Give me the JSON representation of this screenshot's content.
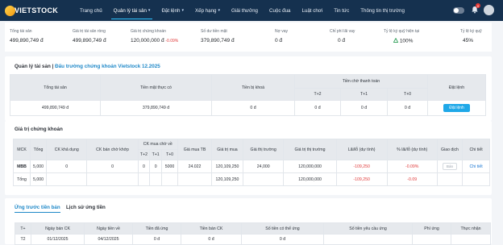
{
  "header": {
    "logo_text": "VIETSTOCK",
    "nav": [
      {
        "label": "Trang chủ",
        "active": false,
        "caret": false
      },
      {
        "label": "Quản lý tài sản",
        "active": true,
        "caret": true
      },
      {
        "label": "Đặt lệnh",
        "active": false,
        "caret": true
      },
      {
        "label": "Xếp hạng",
        "active": false,
        "caret": true
      },
      {
        "label": "Giải thưởng",
        "active": false,
        "caret": false
      },
      {
        "label": "Cuộc đua",
        "active": false,
        "caret": false
      },
      {
        "label": "Luật chơi",
        "active": false,
        "caret": false
      },
      {
        "label": "Tin tức",
        "active": false,
        "caret": false
      },
      {
        "label": "Thông tin thị trường",
        "active": false,
        "caret": false
      }
    ],
    "notification_count": "0",
    "caret_glyph": "▾"
  },
  "summary": [
    {
      "label": "Tổng tài sản",
      "value": "499,890,749 đ"
    },
    {
      "label": "Giá trị tài sản ròng",
      "value": "499,890,749 đ"
    },
    {
      "label": "Giá trị chứng khoán",
      "value": "120,000,000 đ",
      "change": "-0.09%"
    },
    {
      "label": "Số dư tiền mặt",
      "value": "379,890,749 đ"
    },
    {
      "label": "Nợ vay",
      "value": "0 đ"
    },
    {
      "label": "Chỉ phí lãi vay",
      "value": "0 đ"
    },
    {
      "label": "Tỷ lệ ký quỹ hiện tại",
      "value": "100%",
      "icon": "triangle-up-icon"
    },
    {
      "label": "Tỷ lệ ký quỹ",
      "value": "45%"
    }
  ],
  "asset_card": {
    "title": "Quản lý tài sản |",
    "subtitle": "Đấu trường chứng khoán Vietstock 12.2025",
    "headers": {
      "total_assets": "Tổng tài sản",
      "cash_actual": "Tiền mặt thực có",
      "cash_locked": "Tiền bị khoá",
      "cash_pending": "Tiền chờ thanh toán",
      "t2": "T+2",
      "t1": "T+1",
      "t0": "T+0",
      "order": "Đặt lệnh"
    },
    "row": {
      "total_assets": "499,890,749 đ",
      "cash_actual": "379,890,749 đ",
      "cash_locked": "0 đ",
      "t2": "0 đ",
      "t1": "0 đ",
      "t0": "0 đ",
      "order_button": "Đặt lệnh"
    }
  },
  "securities_card": {
    "title": "Giá trị chứng khoán",
    "headers": {
      "symbol": "MCK",
      "total": "Tổng",
      "available": "CK khả dụng",
      "selling_pending": "CK bán chờ khớp",
      "buy_waiting_group": "CK mua chờ về",
      "t2": "T+2",
      "t1": "T+1",
      "t0": "T+0",
      "avg_buy_price": "Giá mua TB",
      "buy_value": "Giá trị mua",
      "market_price": "Giá thị trường",
      "market_value": "Giá trị thị trường",
      "pl": "Lãi/lỗ (dự tính)",
      "pl_pct": "% lãi/lỗ (dự tính)",
      "trade": "Giao dịch",
      "detail": "Chi tiết"
    },
    "rows": [
      {
        "symbol": "MBB",
        "total": "5,000",
        "available": "0",
        "selling_pending": "0",
        "t2": "0",
        "t1": "0",
        "t0": "5000",
        "avg_buy_price": "24.022",
        "buy_value": "120,109,250",
        "market_price": "24,000",
        "market_value": "120,000,000",
        "pl": "-109,250",
        "pl_pct": "-0.09%",
        "trade": "Bán",
        "detail": "Chi tiết"
      }
    ],
    "total_row": {
      "label": "Tổng",
      "total": "5,000",
      "buy_value": "120,109,250",
      "market_value": "120,000,000",
      "pl": "-109,250",
      "pl_pct": "-0.09"
    }
  },
  "advance_card": {
    "tabs": [
      {
        "label": "Ứng trước tiền bán",
        "active": true
      },
      {
        "label": "Lịch sử ứng tiền",
        "active": false
      }
    ],
    "headers": {
      "t": "T+",
      "sell_date": "Ngày bán CK",
      "receive_date": "Ngày tiền về",
      "advanced": "Tiền đã ứng",
      "sell_amount": "Tiền bán CK",
      "advanceable": "Số tiền có thể ứng",
      "requested": "Số tiền yêu cầu ứng",
      "fee": "Phí ứng",
      "actual": "Thực nhận"
    },
    "rows": [
      {
        "t": "T2",
        "sell_date": "01/12/2025",
        "receive_date": "04/12/2025",
        "advanced": "0 đ",
        "sell_amount": "0 đ",
        "advanceable": "0 đ"
      }
    ]
  }
}
